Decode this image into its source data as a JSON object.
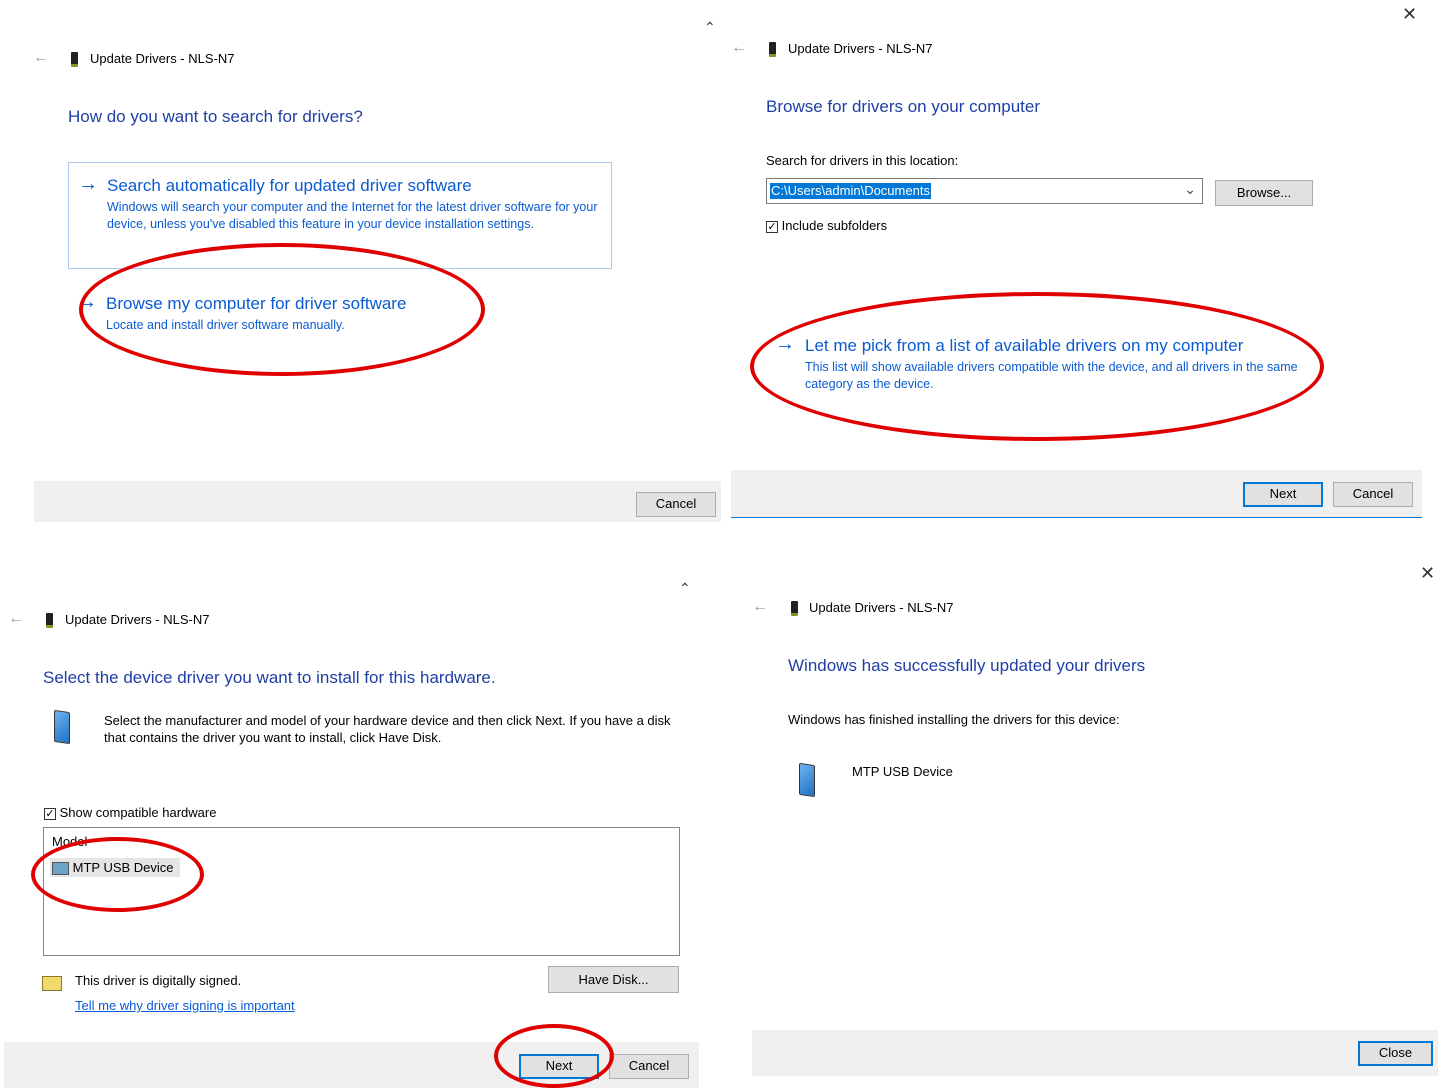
{
  "header_title": "Update Drivers - NLS-N7",
  "panel1": {
    "question": "How do you want to search for drivers?",
    "option1_title": "Search automatically for updated driver software",
    "option1_desc": "Windows will search your computer and the Internet for the latest driver software for your device, unless you've disabled this feature in your device installation settings.",
    "option2_title": "Browse my computer for driver software",
    "option2_desc": "Locate and install driver software manually.",
    "cancel_label": "Cancel"
  },
  "panel2": {
    "heading": "Browse for drivers on your computer",
    "location_label": "Search for drivers in this location:",
    "location_value": "C:\\Users\\admin\\Documents",
    "browse_label": "Browse...",
    "include_subfolders": "Include subfolders",
    "option_title": "Let me pick from a list of available drivers on my computer",
    "option_desc": "This list will show available drivers compatible with the device, and all drivers in the same category as the device.",
    "next_label": "Next",
    "cancel_label": "Cancel"
  },
  "panel3": {
    "heading": "Select the device driver you want to install for this hardware.",
    "instructions": "Select the manufacturer and model of your hardware device and then click Next. If you have a disk that contains the driver you want to install, click Have Disk.",
    "show_compatible": "Show compatible hardware",
    "list_header": "Model",
    "list_item": "MTP USB Device",
    "signed_text": "This driver is digitally signed.",
    "signing_link": "Tell me why driver signing is important",
    "have_disk_label": "Have Disk...",
    "next_label": "Next",
    "cancel_label": "Cancel"
  },
  "panel4": {
    "heading": "Windows has successfully updated your drivers",
    "finished_text": "Windows has finished installing the drivers for this device:",
    "device_name": "MTP USB Device",
    "close_label": "Close"
  },
  "colors": {
    "heading_blue": "#1f3fa6",
    "link_blue": "#0a5bd3",
    "highlight_red": "#e00000",
    "focus_blue": "#0078d7"
  }
}
